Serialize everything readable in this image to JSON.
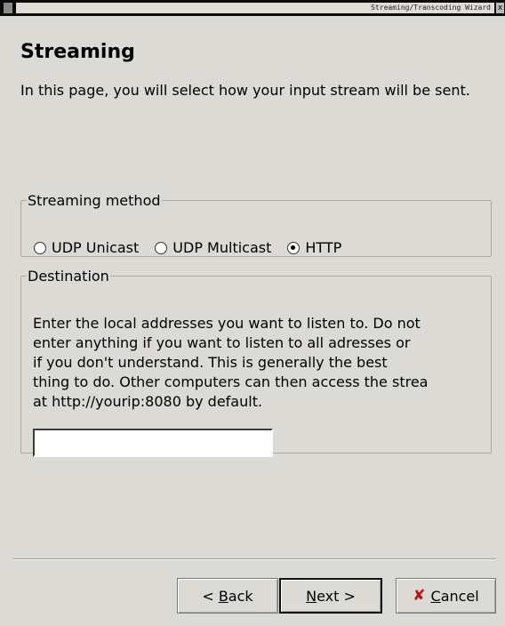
{
  "window": {
    "title": "Streaming/Transcoding Wizard",
    "close_glyph": "x"
  },
  "page": {
    "title": "Streaming",
    "description": "In this page, you will select how your input stream will be sent."
  },
  "streaming_method": {
    "legend": "Streaming method",
    "options": [
      {
        "label": "UDP Unicast",
        "checked": false
      },
      {
        "label": "UDP Multicast",
        "checked": false
      },
      {
        "label": "HTTP",
        "checked": true
      }
    ]
  },
  "destination": {
    "legend": "Destination",
    "help_text": "Enter the local addresses you want to listen to. Do not\nenter anything if you want to listen to all adresses or\nif you don't understand. This is generally the best\nthing to do. Other computers can then access the strea\nat http://yourip:8080 by default.",
    "address_value": ""
  },
  "buttons": {
    "back_prefix": "< ",
    "back_mnemonic": "B",
    "back_rest": "ack",
    "next_mnemonic": "N",
    "next_rest": "ext >",
    "cancel_mnemonic": "C",
    "cancel_rest": "ancel",
    "cancel_icon": "✘"
  }
}
